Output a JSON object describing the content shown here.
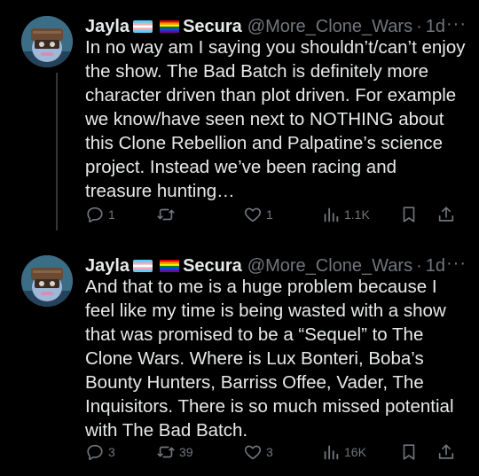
{
  "tweets": [
    {
      "display_name_prefix": "Jayla",
      "display_name_suffix": "Secura",
      "handle": "@More_Clone_Wars",
      "separator": "·",
      "time": "1d",
      "text": "In no way am I saying you shouldn’t/can’t enjoy the show. The Bad Batch is definitely more character driven than plot driven. For example we know/have seen next to NOTHING about this Clone Rebellion and Palpatine’s science project. Instead we’ve been racing and treasure hunting…",
      "replies": "1",
      "reposts": "",
      "likes": "1",
      "views": "1.1K"
    },
    {
      "display_name_prefix": "Jayla",
      "display_name_suffix": "Secura",
      "handle": "@More_Clone_Wars",
      "separator": "·",
      "time": "1d",
      "text": "And that to me is a huge problem because I feel like my time is being wasted with a show that was promised to be a “Sequel” to The Clone Wars. Where is Lux Bonteri, Boba’s Bounty Hunters, Barriss Offee, Vader, The Inquisitors. There is so much missed potential with The Bad Batch.",
      "replies": "3",
      "reposts": "39",
      "likes": "3",
      "views": "16K"
    }
  ],
  "icons": {
    "more": "more-horizontal-icon",
    "reply": "reply-icon",
    "repost": "repost-icon",
    "like": "heart-icon",
    "views": "views-icon",
    "bookmark": "bookmark-icon",
    "share": "share-icon"
  },
  "colors": {
    "background": "#000000",
    "text": "#e7e9ea",
    "secondary": "#71767b",
    "thread_line": "#333639"
  },
  "more_glyph": "···"
}
